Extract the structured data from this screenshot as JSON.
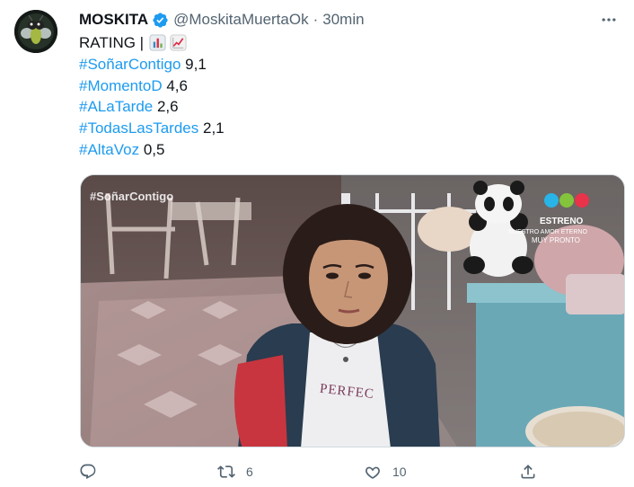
{
  "tweet": {
    "author_name": "MOSKITA",
    "author_handle": "@MoskitaMuertaOk",
    "separator": "·",
    "timestamp": "30min",
    "rating_label": "RATING |",
    "emojis": [
      "bar-chart-emoji",
      "chart-increasing-emoji"
    ],
    "ratings": [
      {
        "hashtag": "#SoñarContigo",
        "value": "9,1"
      },
      {
        "hashtag": "#MomentoD",
        "value": "4,6"
      },
      {
        "hashtag": "#ALaTarde",
        "value": "2,6"
      },
      {
        "hashtag": "#TodasLasTardes",
        "value": "2,1"
      },
      {
        "hashtag": "#AltaVoz",
        "value": "0,5"
      }
    ],
    "media": {
      "overlay_tag": "#SoñarContigo",
      "network_promo": {
        "line1": "ESTRENO",
        "line2": "NUESTRO AMOR ETERNO",
        "line3": "MUY PRONTO"
      },
      "shirt_text": "PERFEC"
    },
    "actions": {
      "reply_count": "",
      "retweet_count": "6",
      "like_count": "10",
      "share_count": ""
    }
  },
  "colors": {
    "link": "#1d9bf0",
    "secondary": "#536471",
    "verified": "#1d9bf0",
    "telefe_dots": [
      "#28b4e6",
      "#84c43c",
      "#e8334a"
    ]
  }
}
